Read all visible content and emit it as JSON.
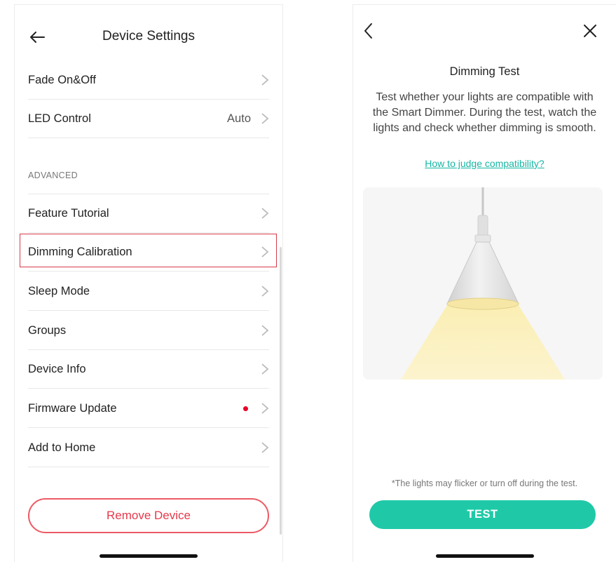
{
  "left": {
    "title": "Device Settings",
    "rows_top": [
      {
        "label": "Fade On&Off",
        "value": ""
      },
      {
        "label": "LED Control",
        "value": "Auto"
      }
    ],
    "section_label": "ADVANCED",
    "rows_advanced": [
      {
        "label": "Feature Tutorial"
      },
      {
        "label": "Dimming Calibration"
      },
      {
        "label": "Sleep Mode"
      },
      {
        "label": "Groups"
      },
      {
        "label": "Device Info"
      },
      {
        "label": "Firmware Update"
      },
      {
        "label": "Add to Home"
      }
    ],
    "remove_button": "Remove Device"
  },
  "right": {
    "title": "Dimming Test",
    "description": "Test whether your lights are compatible with the Smart Dimmer. During the test, watch the lights and check whether dimming is smooth.",
    "link": "How to judge compatibility?",
    "note": "*The lights may flicker or turn off during the test.",
    "test_button": "TEST"
  },
  "colors": {
    "accent": "#1fc9a8",
    "danger": "#e7384b",
    "highlight": "#d73a49",
    "notification_dot": "#e8002a"
  },
  "icons": {
    "back": "arrow-left-icon",
    "chevron": "chevron-right-icon",
    "close": "close-icon",
    "lamp": "pendant-lamp-illustration"
  }
}
